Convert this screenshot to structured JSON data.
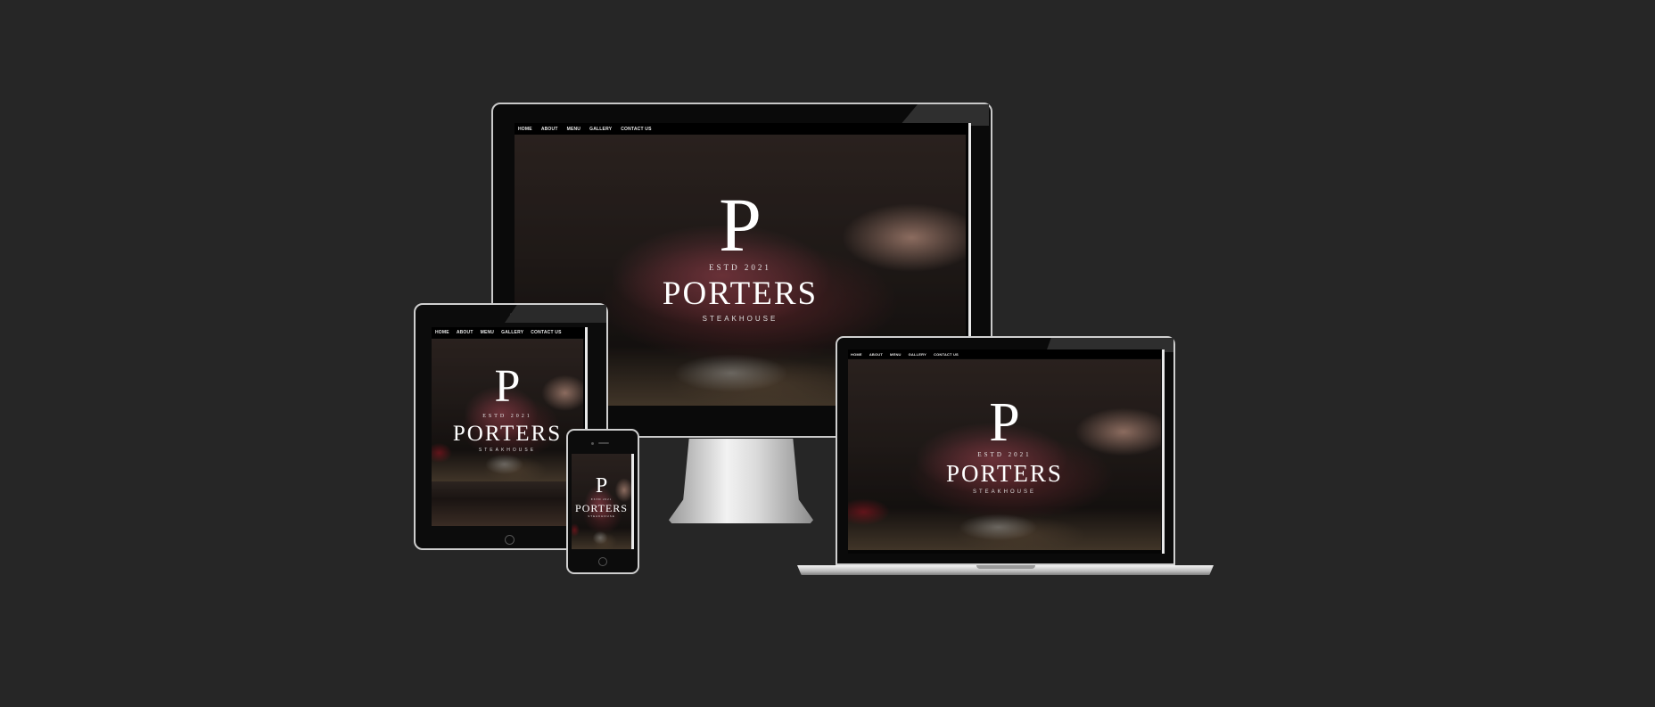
{
  "nav": [
    "HOME",
    "ABOUT",
    "MENU",
    "GALLERY",
    "CONTACT US"
  ],
  "brand": {
    "monogram": "P",
    "established": "ESTD 2021",
    "name": "PORTERS",
    "tagline": "STEAKHOUSE"
  },
  "colors": {
    "background": "#262626",
    "frame": "#000000",
    "silver": "#c8c8c8",
    "text": "#ffffff"
  },
  "icons": {
    "home_button": "home-button-icon",
    "camera": "camera-icon"
  }
}
